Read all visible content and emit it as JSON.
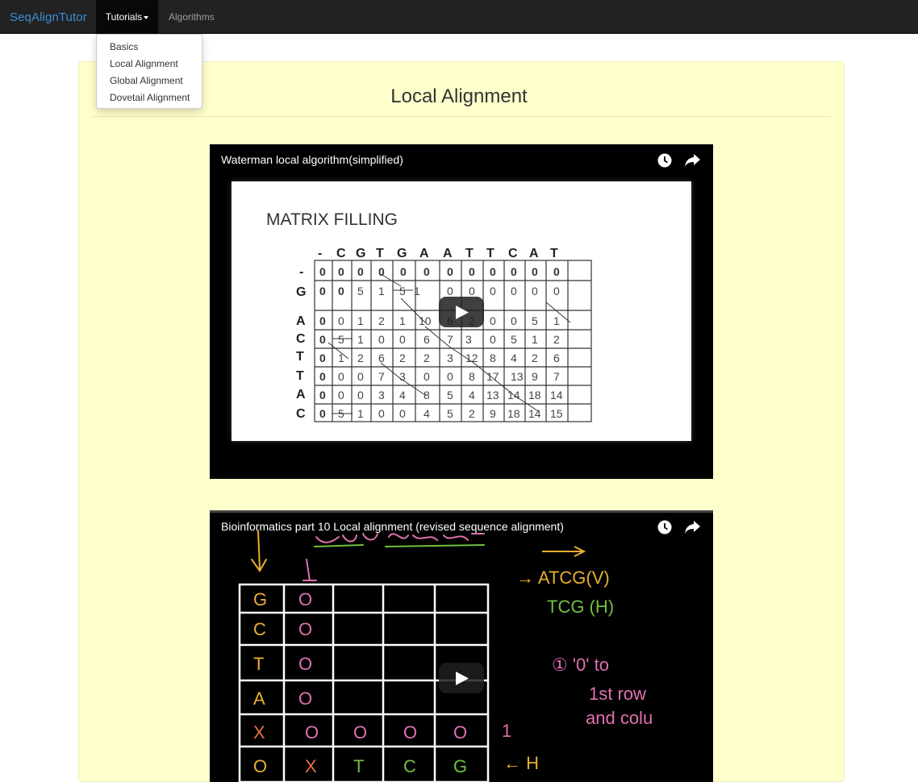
{
  "navbar": {
    "brand": "SeqAlignTutor",
    "tutorials_label": "Tutorials",
    "algorithms_label": "Algorithms"
  },
  "dropdown": {
    "items": [
      "Basics",
      "Local Alignment",
      "Global Alignment",
      "Dovetail Alignment"
    ]
  },
  "page": {
    "title": "Local Alignment"
  },
  "videos": [
    {
      "title": "Waterman local algorithm(simplified)",
      "slide_heading": "MATRIX FILLING"
    },
    {
      "title": "Bioinformatics part 10 Local alignment (revised sequence alignment)"
    }
  ],
  "icons": [
    "watch-later-icon",
    "share-icon",
    "play-icon",
    "caret-down-icon"
  ],
  "colors": {
    "navbar_bg": "#222222",
    "brand": "#3a8ed8",
    "panel_bg": "#ffffcc",
    "video_bg": "#000000"
  }
}
